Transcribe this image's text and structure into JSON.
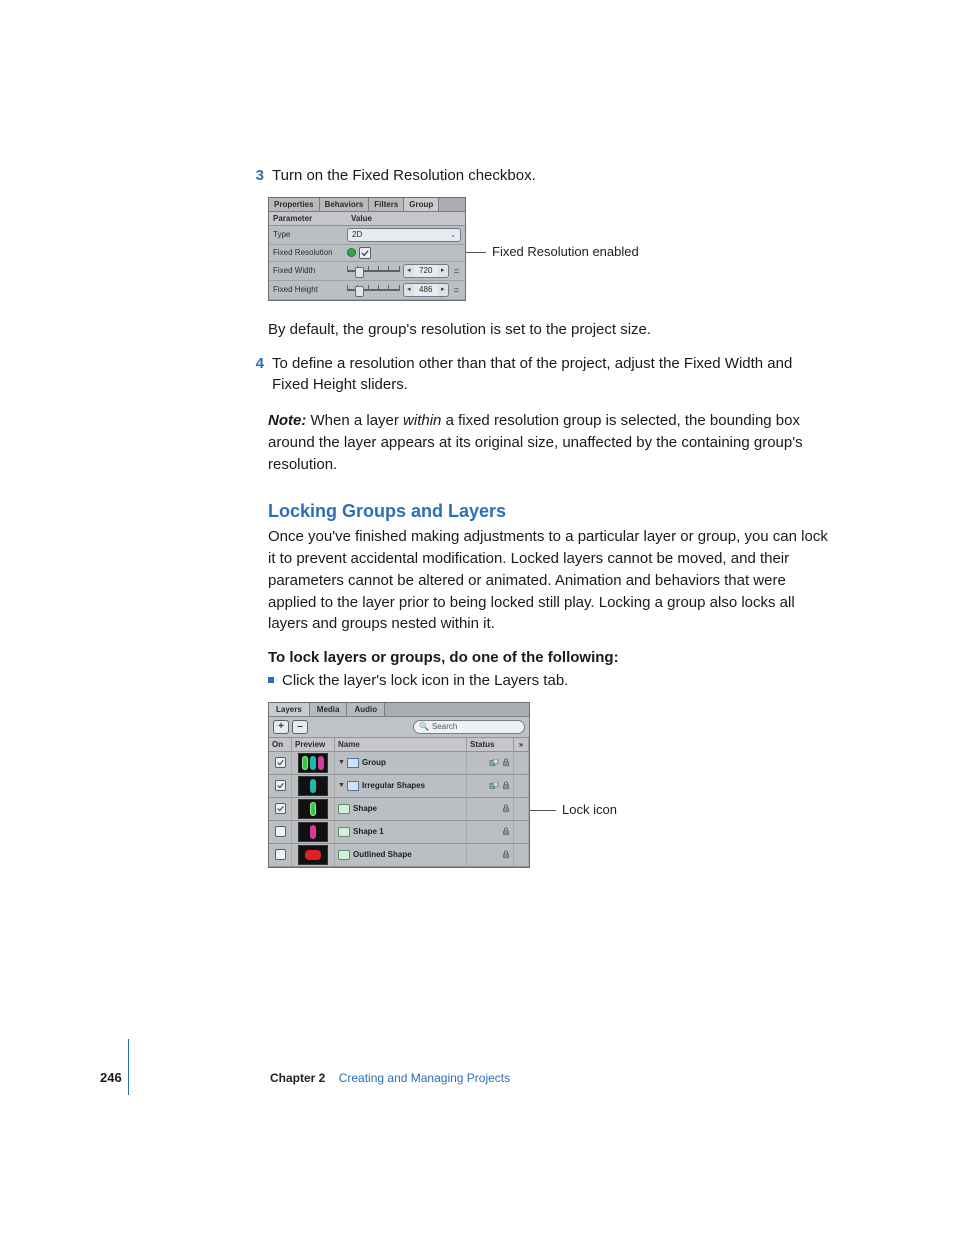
{
  "steps": {
    "s3": {
      "num": "3",
      "text": "Turn on the Fixed Resolution checkbox."
    },
    "s3b": "By default, the group's resolution is set to the project size.",
    "s4": {
      "num": "4",
      "text": "To define a resolution other than that of the project, adjust the Fixed Width and Fixed Height sliders."
    }
  },
  "note": {
    "label": "Note:",
    "before": "When a layer",
    "emph": "within",
    "after": "a fixed resolution group is selected, the bounding box around the layer appears at its original size, unaffected by the containing group's resolution."
  },
  "section": {
    "heading": "Locking Groups and Layers",
    "body": "Once you've finished making adjustments to a particular layer or group, you can lock it to prevent accidental modification. Locked layers cannot be moved, and their parameters cannot be altered or animated. Animation and behaviors that were applied to the layer prior to being locked still play. Locking a group also locks all layers and groups nested within it."
  },
  "instruction": {
    "bold": "To lock layers or groups, do one of the following:",
    "bullet": "Click the layer's lock icon in the Layers tab."
  },
  "fig1": {
    "tabs": {
      "t1": "Properties",
      "t2": "Behaviors",
      "t3": "Filters",
      "t4": "Group"
    },
    "head": {
      "c1": "Parameter",
      "c2": "Value"
    },
    "rows": {
      "type_label": "Type",
      "type_value": "2D",
      "fr_label": "Fixed Resolution",
      "fw_label": "Fixed Width",
      "fw_value": "720",
      "fh_label": "Fixed Height",
      "fh_value": "486"
    },
    "callout": "Fixed Resolution enabled"
  },
  "fig2": {
    "tabs": {
      "t1": "Layers",
      "t2": "Media",
      "t3": "Audio"
    },
    "toolbar": {
      "plus": "+",
      "minus": "–",
      "search_placeholder": "Search"
    },
    "head": {
      "on": "On",
      "prev": "Preview",
      "name": "Name",
      "stat": "Status",
      "arrow": "»"
    },
    "rows": {
      "r1": "Group",
      "r2": "Irregular Shapes",
      "r3": "Shape",
      "r4": "Shape 1",
      "r5": "Outlined Shape"
    },
    "callout": "Lock icon"
  },
  "footer": {
    "page": "246",
    "chapter_label": "Chapter 2",
    "chapter_title": "Creating and Managing Projects"
  }
}
